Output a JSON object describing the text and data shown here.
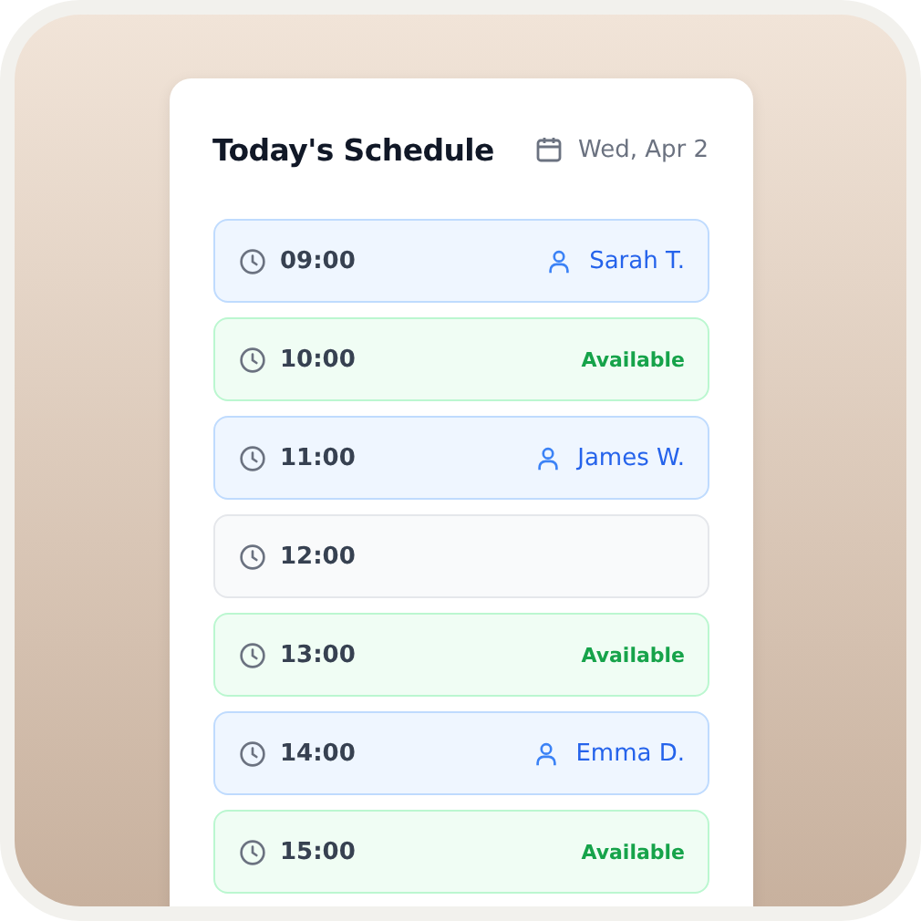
{
  "header": {
    "title": "Today's Schedule",
    "date": "Wed, Apr 2"
  },
  "slots": [
    {
      "time": "09:00",
      "kind": "booked",
      "name": "Sarah T."
    },
    {
      "time": "10:00",
      "kind": "available",
      "label": "Available"
    },
    {
      "time": "11:00",
      "kind": "booked",
      "name": "James W."
    },
    {
      "time": "12:00",
      "kind": "blocked"
    },
    {
      "time": "13:00",
      "kind": "available",
      "label": "Available"
    },
    {
      "time": "14:00",
      "kind": "booked",
      "name": "Emma D."
    },
    {
      "time": "15:00",
      "kind": "available",
      "label": "Available"
    }
  ]
}
